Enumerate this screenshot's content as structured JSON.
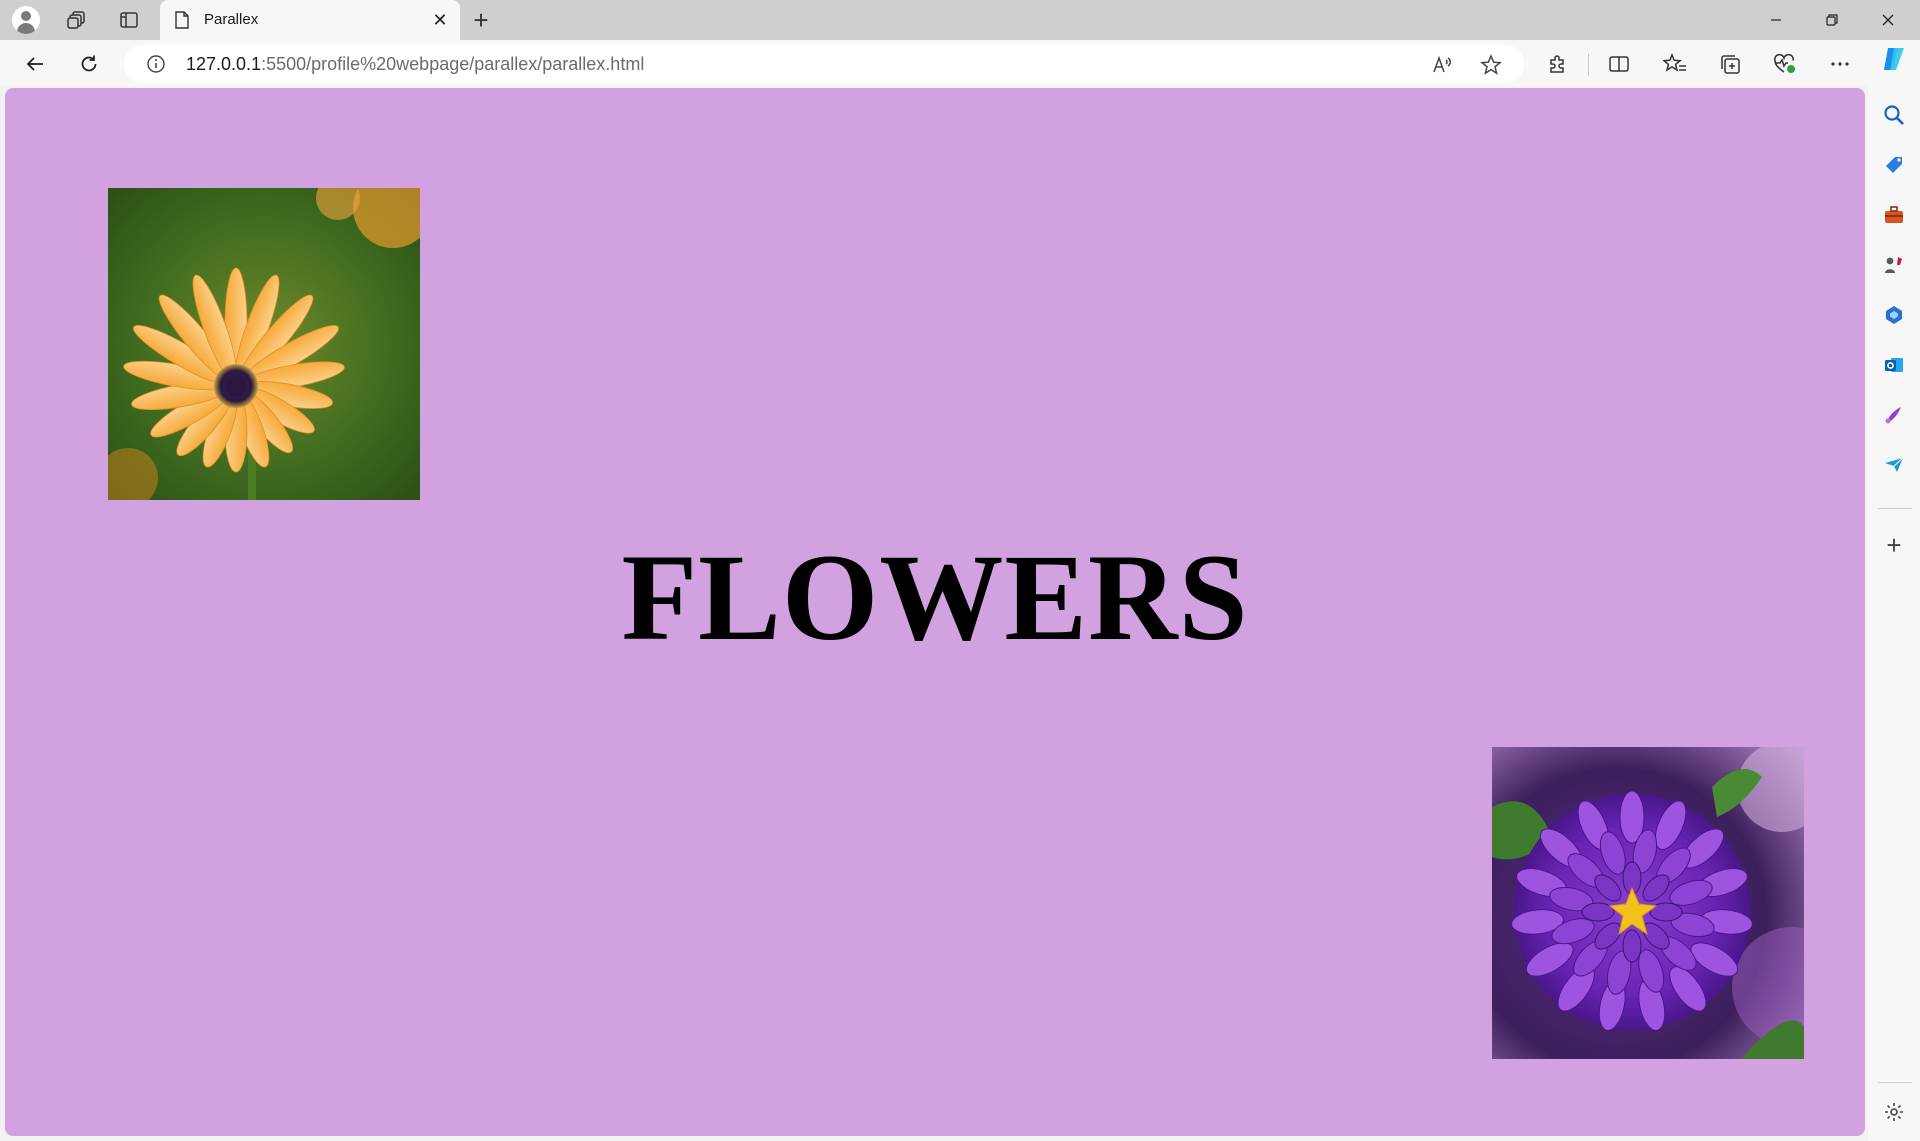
{
  "browser": {
    "tab": {
      "title": "Parallex",
      "close_glyph": "✕"
    },
    "new_tab_glyph": "+",
    "address": {
      "url_host": "127.0.0.1",
      "url_path": ":5500/profile%20webpage/parallex/parallex.html"
    },
    "icons": {
      "profile": "profile-avatar-icon",
      "workspaces": "workspaces-icon",
      "vertical_tabs": "vertical-tabs-icon",
      "back": "back-arrow-icon",
      "refresh": "refresh-icon",
      "site_info": "info-icon",
      "read_aloud": "read-aloud-icon",
      "favorite": "star-icon",
      "extensions": "extensions-icon",
      "split_screen": "split-screen-icon",
      "favorites": "favorites-icon",
      "collections": "collections-icon",
      "browser_essentials": "heart-pulse-icon",
      "more": "more-dots-icon",
      "copilot": "copilot-icon"
    },
    "sidebar": {
      "items": [
        "search-icon",
        "shopping-tag-icon",
        "tools-briefcase-icon",
        "games-icon",
        "microsoft365-icon",
        "outlook-icon",
        "designer-icon",
        "drop-icon"
      ],
      "add_glyph": "+",
      "settings": "gear-icon"
    }
  },
  "page": {
    "background_color": "#d2a2e0",
    "heading": "FLOWERS",
    "images": [
      {
        "subject": "orange daisy flower"
      },
      {
        "subject": "purple aster flower"
      }
    ]
  }
}
